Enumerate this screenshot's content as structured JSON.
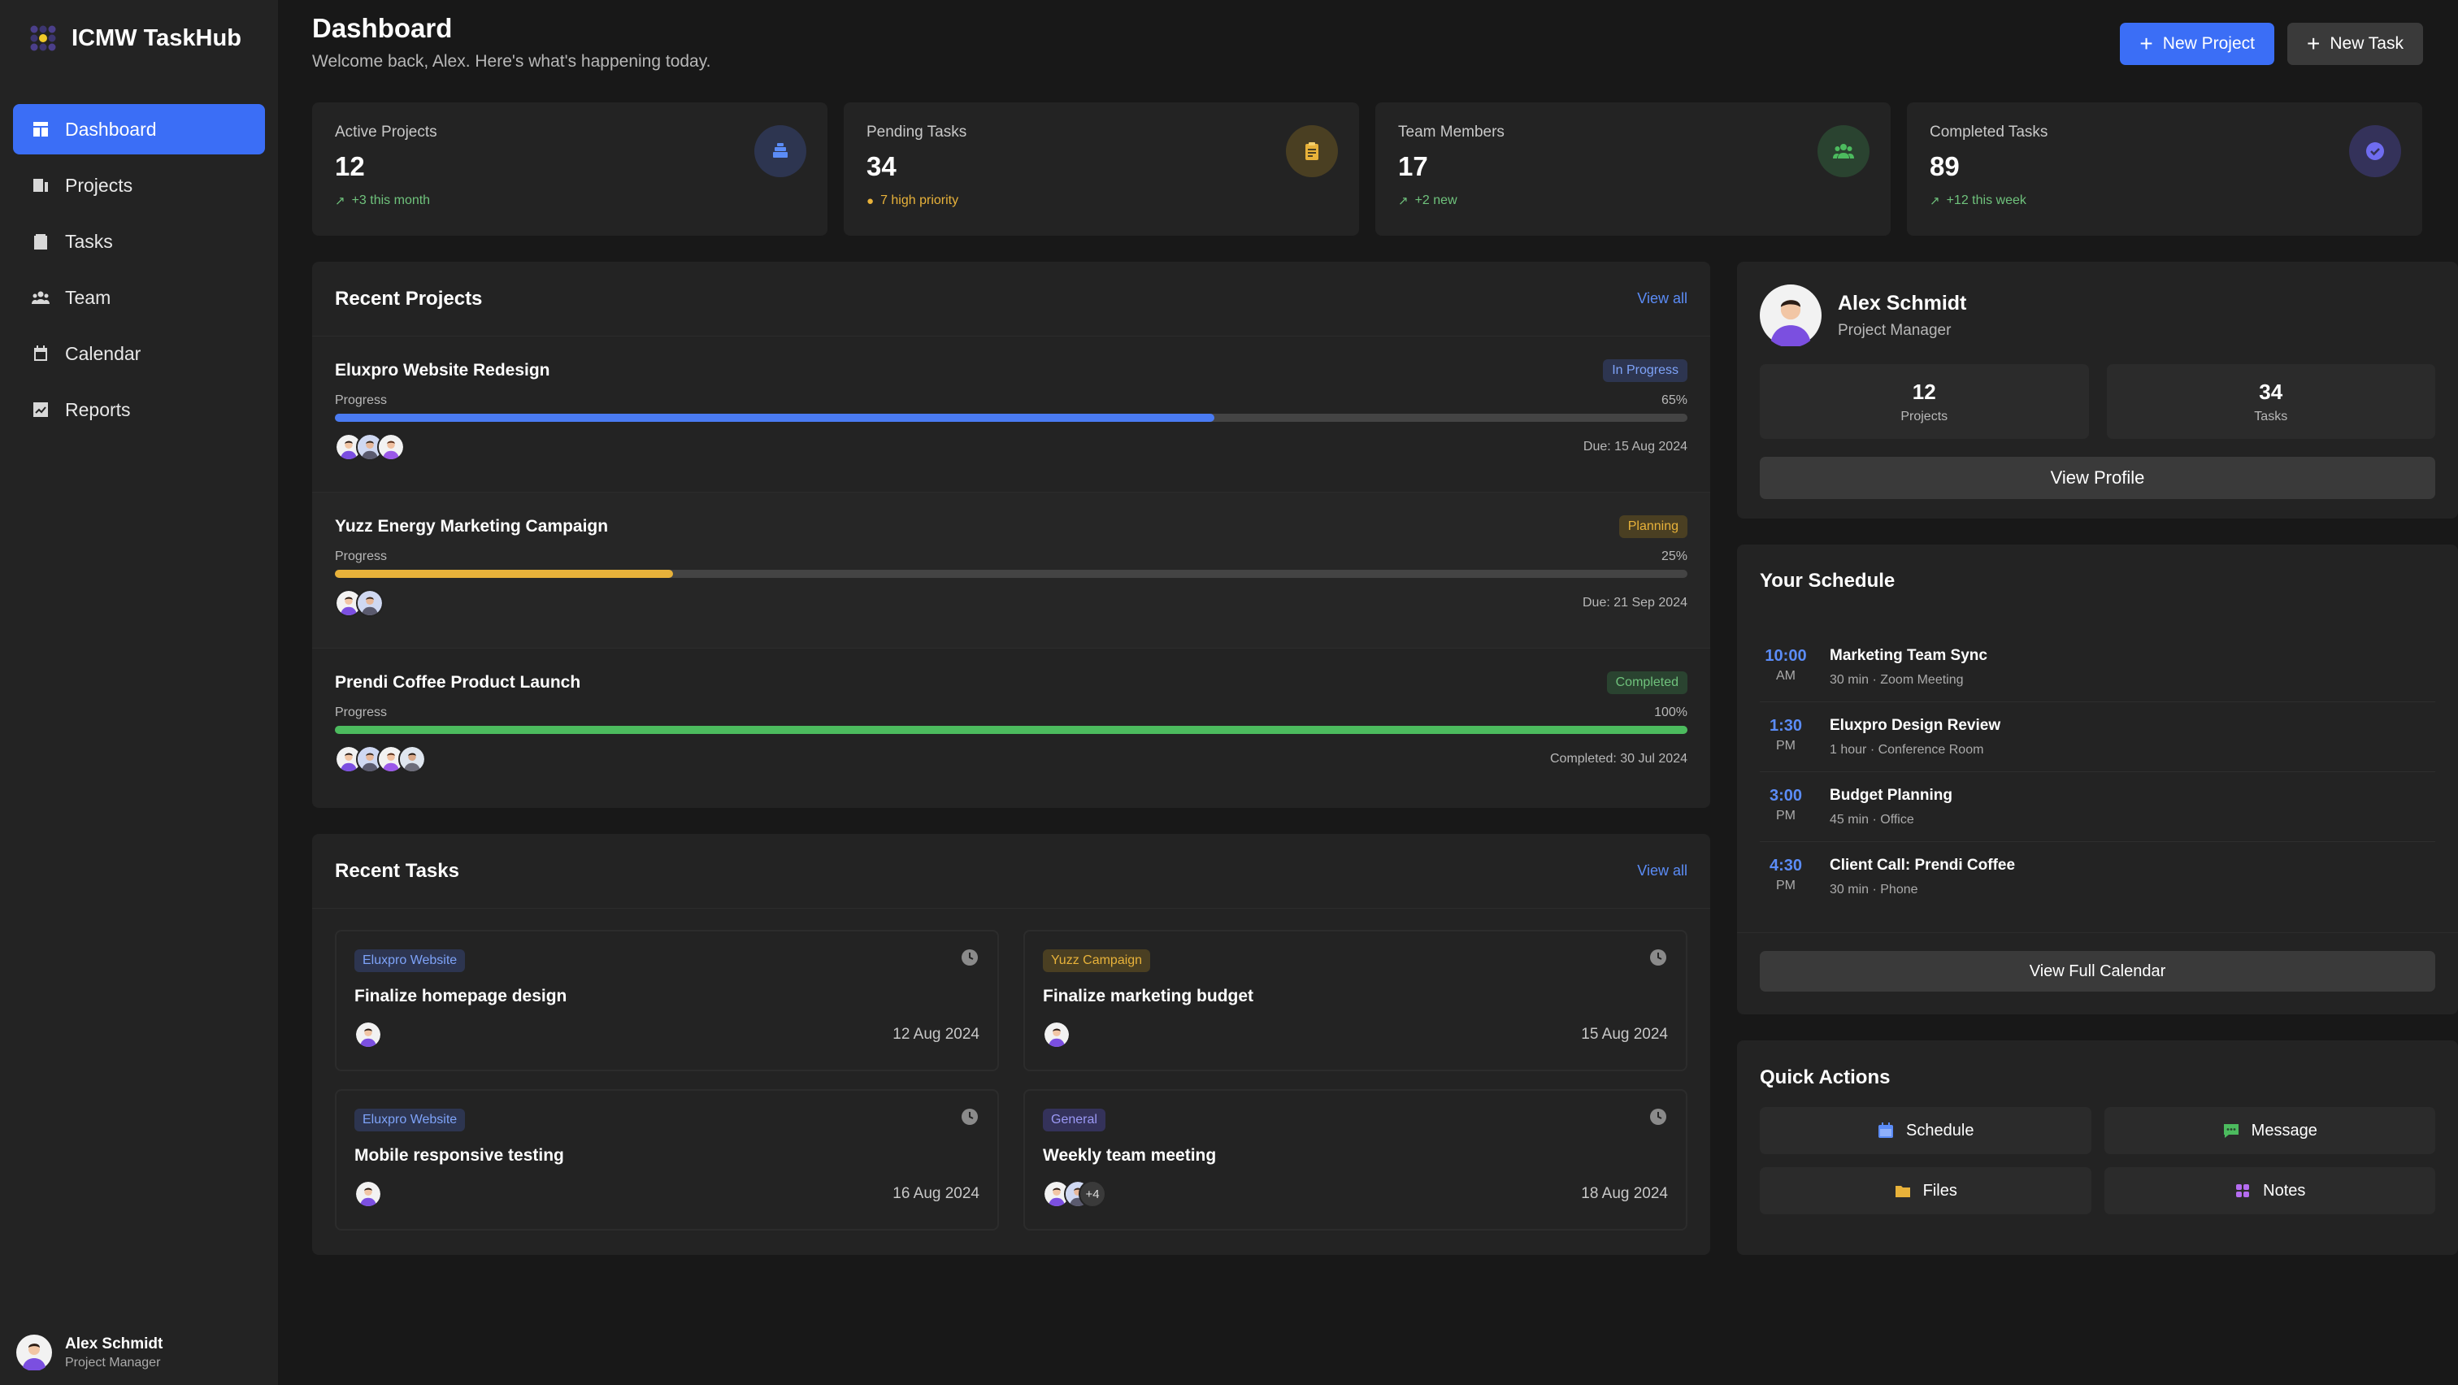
{
  "app": {
    "name": "ICMW TaskHub"
  },
  "nav": [
    {
      "label": "Dashboard",
      "icon": "dashboard-icon",
      "active": true
    },
    {
      "label": "Projects",
      "icon": "projects-icon"
    },
    {
      "label": "Tasks",
      "icon": "tasks-icon"
    },
    {
      "label": "Team",
      "icon": "team-icon"
    },
    {
      "label": "Calendar",
      "icon": "calendar-icon"
    },
    {
      "label": "Reports",
      "icon": "reports-icon"
    }
  ],
  "sidebar_user": {
    "name": "Alex Schmidt",
    "role": "Project Manager"
  },
  "header": {
    "title": "Dashboard",
    "subtitle": "Welcome back, Alex. Here's what's happening today.",
    "new_project": "New Project",
    "new_task": "New Task"
  },
  "stats": [
    {
      "label": "Active Projects",
      "value": "12",
      "note": "+3 this month",
      "icon": "layers-icon",
      "color": "#5b8cf7"
    },
    {
      "label": "Pending Tasks",
      "value": "34",
      "note": "7 high priority",
      "icon": "clipboard-icon",
      "color": "#e8b23a"
    },
    {
      "label": "Team Members",
      "value": "17",
      "note": "+2 new",
      "icon": "users-icon",
      "color": "#4cbb5e"
    },
    {
      "label": "Completed Tasks",
      "value": "89",
      "note": "+12 this week",
      "icon": "check-circle-icon",
      "color": "#6f6cf0"
    }
  ],
  "recent_projects": {
    "title": "Recent Projects",
    "view_all": "View all",
    "progress_label": "Progress",
    "items": [
      {
        "name": "Eluxpro Website Redesign",
        "status": "In Progress",
        "progress": 65,
        "progress_text": "65%",
        "due": "Due: 15 Aug 2024",
        "color": "#4a7bf2",
        "avatars": 3
      },
      {
        "name": "Yuzz Energy Marketing Campaign",
        "status": "Planning",
        "progress": 25,
        "progress_text": "25%",
        "due": "Due: 21 Sep 2024",
        "color": "#e8b23a",
        "avatars": 2
      },
      {
        "name": "Prendi Coffee Product Launch",
        "status": "Completed",
        "progress": 100,
        "progress_text": "100%",
        "due": "Completed: 30 Jul 2024",
        "color": "#4cbb5e",
        "avatars": 4
      }
    ]
  },
  "recent_tasks": {
    "title": "Recent Tasks",
    "view_all": "View all",
    "items": [
      {
        "tag": "Eluxpro Website",
        "title": "Finalize homepage design",
        "date": "12 Aug 2024"
      },
      {
        "tag": "Yuzz Campaign",
        "title": "Finalize marketing budget",
        "date": "15 Aug 2024"
      },
      {
        "tag": "Eluxpro Website",
        "title": "Mobile responsive testing",
        "date": "16 Aug 2024"
      },
      {
        "tag": "General",
        "title": "Weekly team meeting",
        "date": "18 Aug 2024",
        "more": "+4"
      }
    ]
  },
  "profile": {
    "name": "Alex Schmidt",
    "role": "Project Manager",
    "projects_value": "12",
    "projects_label": "Projects",
    "tasks_value": "34",
    "tasks_label": "Tasks",
    "view_profile": "View Profile"
  },
  "schedule": {
    "title": "Your Schedule",
    "items": [
      {
        "time": "10:00",
        "period": "AM",
        "title": "Marketing Team Sync",
        "meta": "30 min · Zoom Meeting"
      },
      {
        "time": "1:30",
        "period": "PM",
        "title": "Eluxpro Design Review",
        "meta": "1 hour · Conference Room"
      },
      {
        "time": "3:00",
        "period": "PM",
        "title": "Budget Planning",
        "meta": "45 min · Office"
      },
      {
        "time": "4:30",
        "period": "PM",
        "title": "Client Call: Prendi Coffee",
        "meta": "30 min · Phone"
      }
    ],
    "view_full": "View Full Calendar"
  },
  "quick_actions": {
    "title": "Quick Actions",
    "items": [
      {
        "label": "Schedule",
        "icon": "calendar-icon",
        "color": "#5b8cf7"
      },
      {
        "label": "Message",
        "icon": "chat-icon",
        "color": "#4cbb5e"
      },
      {
        "label": "Files",
        "icon": "folder-icon",
        "color": "#e8b23a"
      },
      {
        "label": "Notes",
        "icon": "apps-icon",
        "color": "#b56cf0"
      }
    ]
  }
}
